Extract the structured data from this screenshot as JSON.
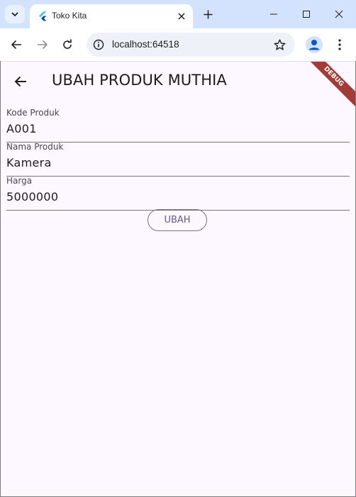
{
  "browser": {
    "tab_title": "Toko Kita",
    "url": "localhost:64518"
  },
  "app": {
    "title": "UBAH PRODUK MUTHIA",
    "debug_banner": "DEBUG",
    "fields": [
      {
        "label": "Kode Produk",
        "value": "A001"
      },
      {
        "label": "Nama Produk",
        "value": "Kamera"
      },
      {
        "label": "Harga",
        "value": "5000000"
      }
    ],
    "submit_label": "UBAH"
  },
  "colors": {
    "tabbar": "#d3e3fd",
    "app_background": "#fdf7ff",
    "button_text": "#65558f",
    "debug_banner": "#a33c36"
  }
}
